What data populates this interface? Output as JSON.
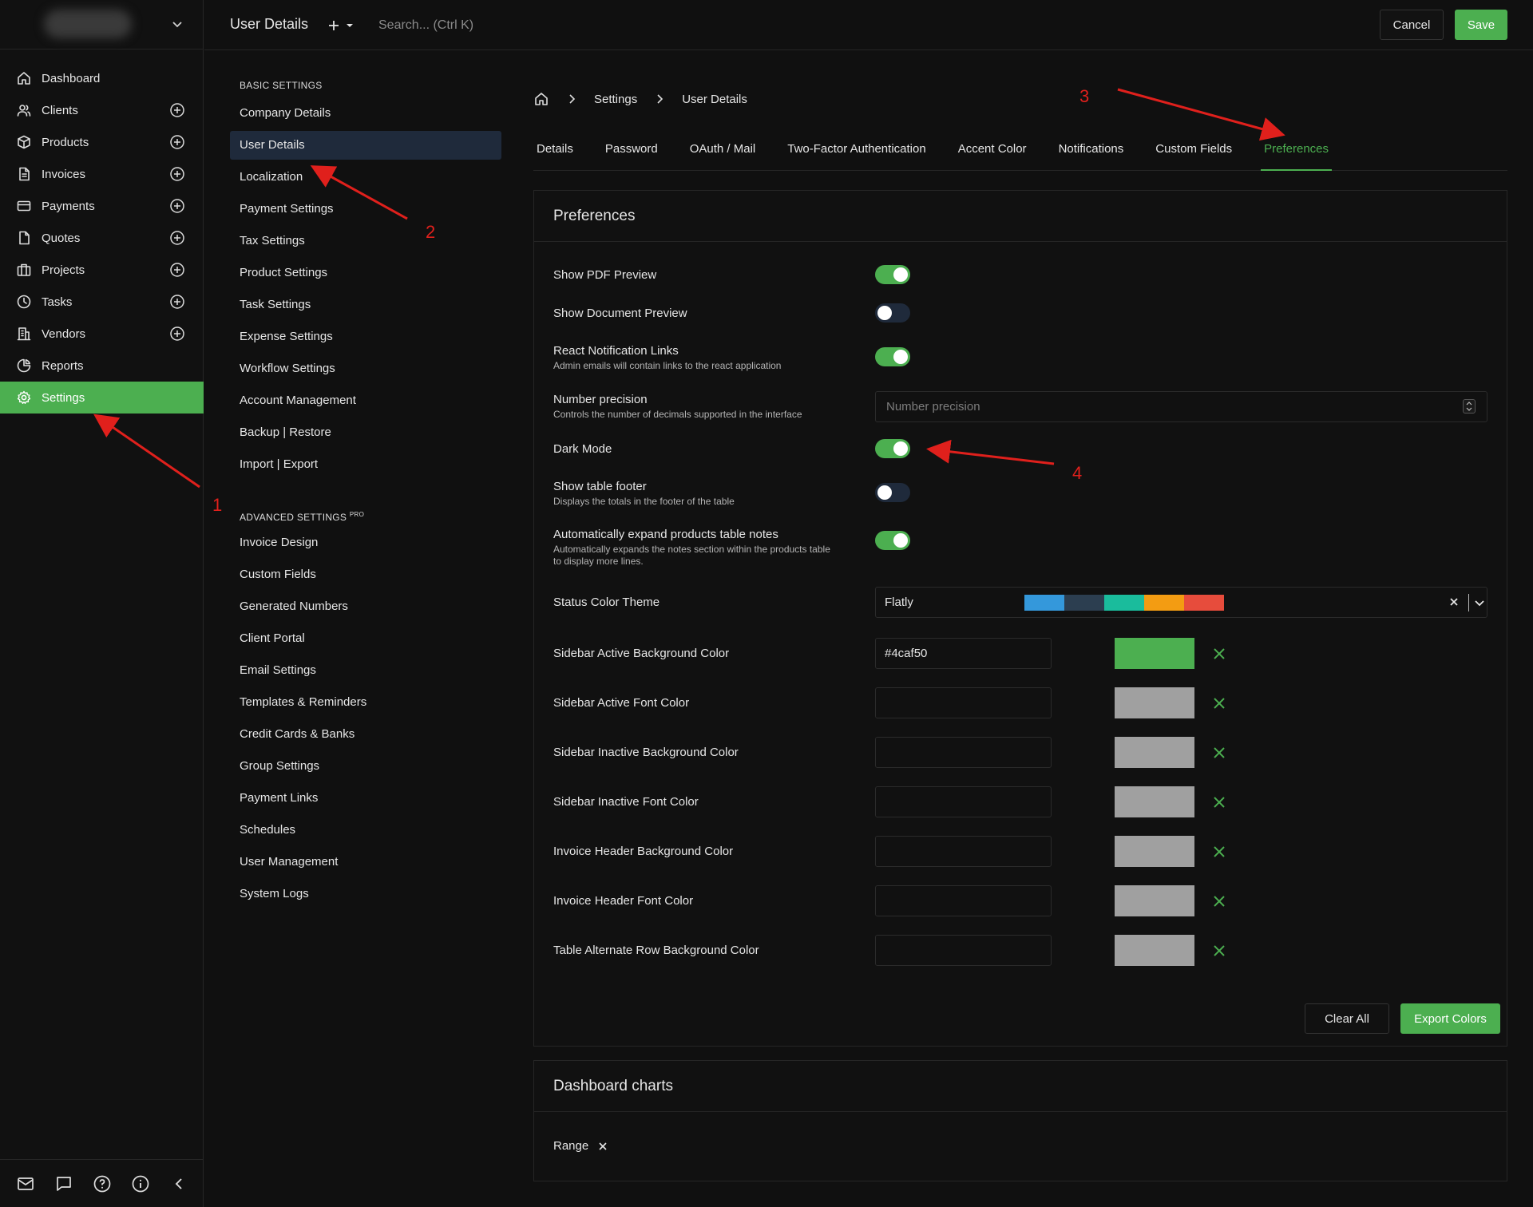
{
  "topbar": {
    "title": "User Details",
    "search_placeholder": "Search... (Ctrl K)",
    "cancel_label": "Cancel",
    "save_label": "Save"
  },
  "sidebar": {
    "items": [
      {
        "label": "Dashboard",
        "icon": "home-icon",
        "has_add": false
      },
      {
        "label": "Clients",
        "icon": "users-icon",
        "has_add": true
      },
      {
        "label": "Products",
        "icon": "box-icon",
        "has_add": true
      },
      {
        "label": "Invoices",
        "icon": "file-text-icon",
        "has_add": true
      },
      {
        "label": "Payments",
        "icon": "credit-card-icon",
        "has_add": true
      },
      {
        "label": "Quotes",
        "icon": "file-icon",
        "has_add": true
      },
      {
        "label": "Projects",
        "icon": "briefcase-icon",
        "has_add": true
      },
      {
        "label": "Tasks",
        "icon": "clock-icon",
        "has_add": true
      },
      {
        "label": "Vendors",
        "icon": "building-icon",
        "has_add": true
      },
      {
        "label": "Reports",
        "icon": "pie-chart-icon",
        "has_add": false
      },
      {
        "label": "Settings",
        "icon": "gear-icon",
        "has_add": false
      }
    ],
    "active_item": "Settings",
    "active_color": "#4caf50",
    "bottom_icons": [
      "mail-icon",
      "chat-icon",
      "help-icon",
      "info-icon",
      "collapse-icon"
    ]
  },
  "settings_nav": {
    "basic_heading": "BASIC SETTINGS",
    "basic_items": [
      "Company Details",
      "User Details",
      "Localization",
      "Payment Settings",
      "Tax Settings",
      "Product Settings",
      "Task Settings",
      "Expense Settings",
      "Workflow Settings",
      "Account Management",
      "Backup | Restore",
      "Import | Export"
    ],
    "active_item": "User Details",
    "advanced_heading": "ADVANCED SETTINGS",
    "advanced_badge": "PRO",
    "advanced_items": [
      "Invoice Design",
      "Custom Fields",
      "Generated Numbers",
      "Client Portal",
      "Email Settings",
      "Templates & Reminders",
      "Credit Cards & Banks",
      "Group Settings",
      "Payment Links",
      "Schedules",
      "User Management",
      "System Logs"
    ]
  },
  "breadcrumb": {
    "items": [
      "Settings",
      "User Details"
    ]
  },
  "tabs": {
    "items": [
      "Details",
      "Password",
      "OAuth / Mail",
      "Two-Factor Authentication",
      "Accent Color",
      "Notifications",
      "Custom Fields",
      "Preferences"
    ],
    "active": "Preferences"
  },
  "preferences": {
    "title": "Preferences",
    "toggles": [
      {
        "label": "Show PDF Preview",
        "help": "",
        "on": true
      },
      {
        "label": "Show Document Preview",
        "help": "",
        "on": false
      },
      {
        "label": "React Notification Links",
        "help": "Admin emails will contain links to the react application",
        "on": true
      },
      {
        "label": "Dark Mode",
        "help": "",
        "on": true
      },
      {
        "label": "Show table footer",
        "help": "Displays the totals in the footer of the table",
        "on": false
      },
      {
        "label": "Automatically expand products table notes",
        "help": "Automatically expands the notes section within the products table to display more lines.",
        "on": true
      }
    ],
    "number_precision": {
      "label": "Number precision",
      "help": "Controls the number of decimals supported in the interface",
      "placeholder": "Number precision",
      "value": ""
    },
    "status_color_theme": {
      "label": "Status Color Theme",
      "value": "Flatly",
      "swatches": [
        "#3498db",
        "#2c3e50",
        "#1abc9c",
        "#f39c12",
        "#e74c3c"
      ]
    },
    "color_fields": [
      {
        "label": "Sidebar Active Background Color",
        "value": "#4caf50",
        "swatch": "#4caf50"
      },
      {
        "label": "Sidebar Active Font Color",
        "value": "",
        "swatch": "#a0a0a0"
      },
      {
        "label": "Sidebar Inactive Background Color",
        "value": "",
        "swatch": "#a0a0a0"
      },
      {
        "label": "Sidebar Inactive Font Color",
        "value": "",
        "swatch": "#a0a0a0"
      },
      {
        "label": "Invoice Header Background Color",
        "value": "",
        "swatch": "#a0a0a0"
      },
      {
        "label": "Invoice Header Font Color",
        "value": "",
        "swatch": "#a0a0a0"
      },
      {
        "label": "Table Alternate Row Background Color",
        "value": "",
        "swatch": "#a0a0a0"
      }
    ],
    "clear_all_label": "Clear All",
    "export_colors_label": "Export Colors"
  },
  "dashboard_charts": {
    "title": "Dashboard charts",
    "range_label": "Range"
  },
  "annotations": {
    "numbers": [
      "1",
      "2",
      "3",
      "4"
    ],
    "color": "#e0201c"
  }
}
